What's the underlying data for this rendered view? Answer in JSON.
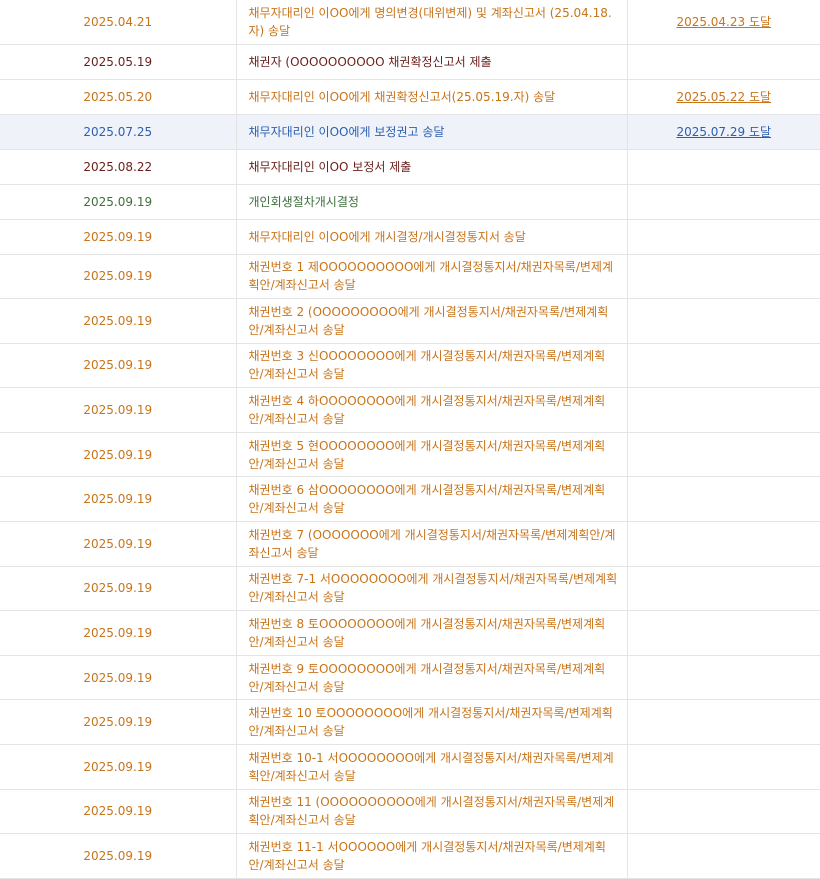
{
  "rows": [
    {
      "date": "2025.04.21",
      "desc": "채무자대리인 이OO에게 명의변경(대위변제) 및 계좌신고서 (25.04.18.자) 송달",
      "received": "2025.04.23 도달",
      "color": "orange",
      "lines": 2
    },
    {
      "date": "2025.05.19",
      "desc": "채권자 (OOOOOOOOOO 채권확정신고서 제출",
      "received": "",
      "color": "maroon",
      "lines": 1
    },
    {
      "date": "2025.05.20",
      "desc": "채무자대리인 이OO에게 채권확정신고서(25.05.19.자) 송달",
      "received": "2025.05.22 도달",
      "color": "orange",
      "lines": 1
    },
    {
      "date": "2025.07.25",
      "desc": "채무자대리인 이OO에게 보정권고 송달",
      "received": "2025.07.29 도달",
      "color": "blue",
      "lines": 1,
      "highlight": true
    },
    {
      "date": "2025.08.22",
      "desc": "채무자대리인 이OO 보정서 제출",
      "received": "",
      "color": "maroon",
      "lines": 1
    },
    {
      "date": "2025.09.19",
      "desc": "개인회생절차개시결정",
      "received": "",
      "color": "green",
      "lines": 1
    },
    {
      "date": "2025.09.19",
      "desc": "채무자대리인 이OO에게 개시결정/개시결정통지서 송달",
      "received": "",
      "color": "orange",
      "lines": 1
    },
    {
      "date": "2025.09.19",
      "desc": "채권번호 1 제OOOOOOOOOO에게 개시결정통지서/채권자목록/변제계획안/계좌신고서 송달",
      "received": "",
      "color": "orange",
      "lines": 2
    },
    {
      "date": "2025.09.19",
      "desc": "채권번호 2 (OOOOOOOOO에게 개시결정통지서/채권자목록/변제계획안/계좌신고서 송달",
      "received": "",
      "color": "orange",
      "lines": 2
    },
    {
      "date": "2025.09.19",
      "desc": "채권번호 3 신OOOOOOOO에게 개시결정통지서/채권자목록/변제계획안/계좌신고서 송달",
      "received": "",
      "color": "orange",
      "lines": 2
    },
    {
      "date": "2025.09.19",
      "desc": "채권번호 4 하OOOOOOOO에게 개시결정통지서/채권자목록/변제계획안/계좌신고서 송달",
      "received": "",
      "color": "orange",
      "lines": 2
    },
    {
      "date": "2025.09.19",
      "desc": "채권번호 5 현OOOOOOOO에게 개시결정통지서/채권자목록/변제계획안/계좌신고서 송달",
      "received": "",
      "color": "orange",
      "lines": 2
    },
    {
      "date": "2025.09.19",
      "desc": "채권번호 6 삼OOOOOOOO에게 개시결정통지서/채권자목록/변제계획안/계좌신고서 송달",
      "received": "",
      "color": "orange",
      "lines": 2
    },
    {
      "date": "2025.09.19",
      "desc": "채권번호 7 (OOOOOOO에게 개시결정통지서/채권자목록/변제계획안/계좌신고서 송달",
      "received": "",
      "color": "orange",
      "lines": 2
    },
    {
      "date": "2025.09.19",
      "desc": "채권번호 7-1 서OOOOOOOO에게 개시결정통지서/채권자목록/변제계획안/계좌신고서 송달",
      "received": "",
      "color": "orange",
      "lines": 2
    },
    {
      "date": "2025.09.19",
      "desc": "채권번호 8 토OOOOOOOO에게 개시결정통지서/채권자목록/변제계획안/계좌신고서 송달",
      "received": "",
      "color": "orange",
      "lines": 2
    },
    {
      "date": "2025.09.19",
      "desc": "채권번호 9 토OOOOOOOO에게 개시결정통지서/채권자목록/변제계획안/계좌신고서 송달",
      "received": "",
      "color": "orange",
      "lines": 2
    },
    {
      "date": "2025.09.19",
      "desc": "채권번호 10 토OOOOOOOO에게 개시결정통지서/채권자목록/변제계획안/계좌신고서 송달",
      "received": "",
      "color": "orange",
      "lines": 2
    },
    {
      "date": "2025.09.19",
      "desc": "채권번호 10-1 서OOOOOOOO에게 개시결정통지서/채권자목록/변제계획안/계좌신고서 송달",
      "received": "",
      "color": "orange",
      "lines": 2
    },
    {
      "date": "2025.09.19",
      "desc": "채권번호 11 (OOOOOOOOOO에게 개시결정통지서/채권자목록/변제계획안/계좌신고서 송달",
      "received": "",
      "color": "orange",
      "lines": 2
    },
    {
      "date": "2025.09.19",
      "desc": "채권번호 11-1 서OOOOOO에게 개시결정통지서/채권자목록/변제계획안/계좌신고서 송달",
      "received": "",
      "color": "orange",
      "lines": 2
    }
  ],
  "colors": {
    "orange": "#c8741a",
    "maroon": "#6a1f1b",
    "green": "#3e6f3c",
    "blue": "#2c5fb0",
    "highlight_bg": "#eff3f9",
    "border": "#e4e4e4"
  }
}
